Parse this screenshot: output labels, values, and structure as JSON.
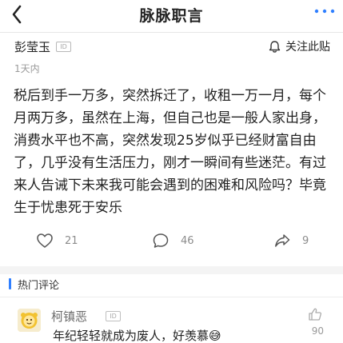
{
  "header": {
    "title": "脉脉职言"
  },
  "post": {
    "author_name": "彭莹玉",
    "author_badge": "ID",
    "follow_label": "关注此贴",
    "time_ago": "1天内",
    "content": "税后到手一万多，突然拆迁了，收租一万一月，每个月两万多，虽然在上海，但自己也是一般人家出身，消费水平也不高，突然发现25岁似乎已经财富自由了，几乎没有生活压力，刚才一瞬间有些迷茫。有过来人告诫下未来我可能会遇到的困难和风险吗？毕竟生于忧患死于安乐"
  },
  "stats": {
    "likes": "21",
    "comments": "46",
    "shares": "9"
  },
  "hot_comments": {
    "header": "热门评论",
    "items": [
      {
        "name": "柯镇恶",
        "badge": "ID",
        "text": "年纪轻轻就成为废人，好羡慕😅",
        "likes": "90"
      }
    ]
  },
  "colors": {
    "accent": "#2f7fff",
    "text": "#222222",
    "muted": "#9a9a9a"
  },
  "icons": {
    "back": "chevron-left-icon",
    "more": "more-dots-icon",
    "follow": "bell-icon",
    "like": "heart-icon",
    "comment": "chat-bubble-icon",
    "share": "share-arrow-icon",
    "comment_like": "thumb-up-icon"
  }
}
